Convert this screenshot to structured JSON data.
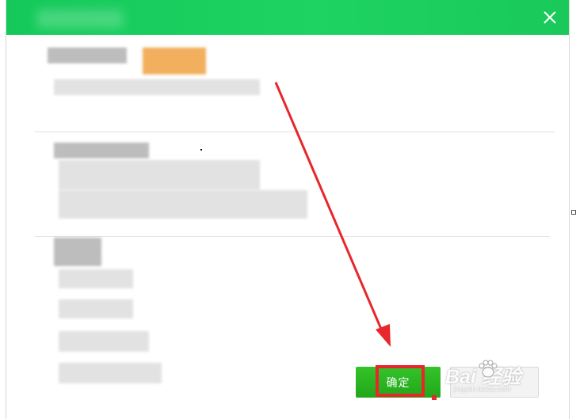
{
  "dialog": {
    "close_icon": "close-icon",
    "title_bar_color": "#1ed361"
  },
  "buttons": {
    "confirm_label": "确定"
  },
  "annotation": {
    "arrow_color": "#e8262b"
  },
  "watermark": {
    "main_text": "Bai  经验",
    "sub_text": "jingyan.baidu.com"
  }
}
